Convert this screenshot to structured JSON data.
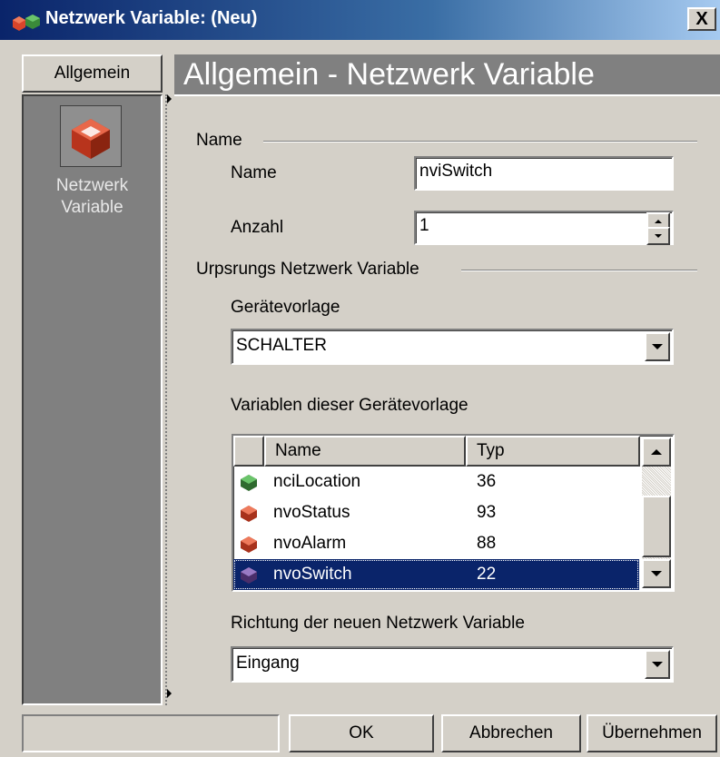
{
  "window": {
    "title": "Netzwerk Variable: (Neu)",
    "close_label": "X"
  },
  "sidebar": {
    "tab_label": "Allgemein",
    "item_label_line1": "Netzwerk",
    "item_label_line2": "Variable"
  },
  "page": {
    "title": "Allgemein - Netzwerk Variable"
  },
  "name_group": {
    "title": "Name",
    "name_label": "Name",
    "name_value": "nviSwitch",
    "count_label": "Anzahl",
    "count_value": "1"
  },
  "source_group": {
    "title": "Urpsrungs Netzwerk Variable",
    "template_label": "Gerätevorlage",
    "template_value": "SCHALTER",
    "variables_label": "Variablen dieser Gerätevorlage",
    "columns": [
      "Name",
      "Typ"
    ],
    "rows": [
      {
        "name": "nciLocation",
        "typ": "36",
        "icon": "network-variable-green-icon",
        "color": "#3a7a3a"
      },
      {
        "name": "nvoStatus",
        "typ": "93",
        "icon": "network-variable-red-icon",
        "color": "#c0402a"
      },
      {
        "name": "nvoAlarm",
        "typ": "88",
        "icon": "network-variable-red-icon",
        "color": "#c0402a"
      },
      {
        "name": "nvoSwitch",
        "typ": "22",
        "icon": "network-variable-purple-icon",
        "color": "#5a3a7a",
        "selected": true
      }
    ],
    "direction_label": "Richtung der neuen Netzwerk Variable",
    "direction_value": "Eingang"
  },
  "buttons": {
    "ok": "OK",
    "cancel": "Abbrechen",
    "apply": "Übernehmen"
  },
  "colors": {
    "selection": "#0a246a",
    "title_gradient_start": "#0a246a",
    "panel_gray": "#808080"
  }
}
